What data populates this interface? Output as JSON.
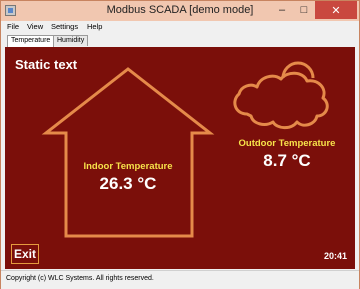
{
  "window": {
    "title": "Modbus SCADA [demo mode]",
    "minimize_icon": "minimize-icon",
    "maximize_icon": "maximize-icon",
    "close_icon": "close-icon",
    "min_glyph": "–",
    "max_glyph": "□",
    "close_glyph": "✕"
  },
  "menu": {
    "items": [
      "File",
      "View",
      "Settings",
      "Help"
    ]
  },
  "tabs": [
    "Temperature",
    "Humidity"
  ],
  "screen": {
    "static_text": "Static text",
    "indoor": {
      "label": "Indoor Temperature",
      "value": "26.3 °C"
    },
    "outdoor": {
      "label": "Outdoor Temperature",
      "value": "8.7 °C"
    },
    "exit_label": "Exit",
    "time": "20:41"
  },
  "status": {
    "text": "Copyright (c) WLC Systems. All rights reserved."
  },
  "colors": {
    "background": "#7b0f0a",
    "outline": "#e58a4a",
    "label_yellow": "#f7e24a",
    "close_red": "#c9483f"
  }
}
